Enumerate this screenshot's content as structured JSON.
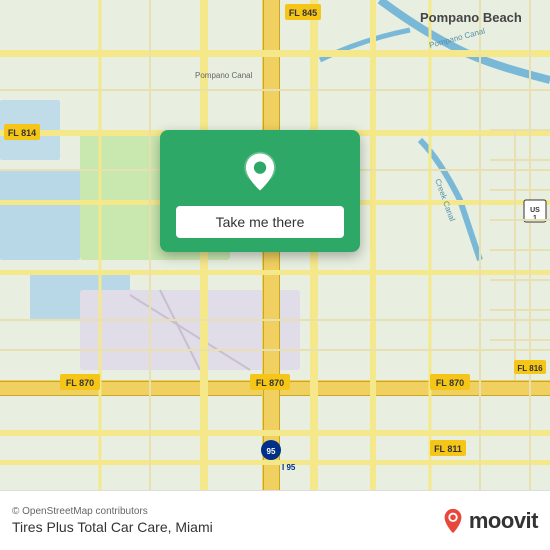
{
  "map": {
    "background_color": "#e8efe8",
    "attribution": "© OpenStreetMap contributors",
    "center_lat": 26.02,
    "center_lng": -80.15
  },
  "card": {
    "button_label": "Take me there",
    "pin_icon": "location-pin"
  },
  "bottom_bar": {
    "place_name": "Tires Plus Total Car Care",
    "city": "Miami",
    "attribution": "© OpenStreetMap contributors",
    "logo_text": "moovit"
  },
  "labels": {
    "pompano_beach": "Pompano Beach",
    "fl_845": "FL 845",
    "fl_814": "FL 814",
    "fl_870_left": "FL 870",
    "fl_870_center": "FL 870",
    "fl_870_right": "FL 870",
    "fl_811": "FL 811",
    "i95": "I 95",
    "pompano_canal": "Pompano Canal",
    "creek_canal": "Creek Canal"
  }
}
